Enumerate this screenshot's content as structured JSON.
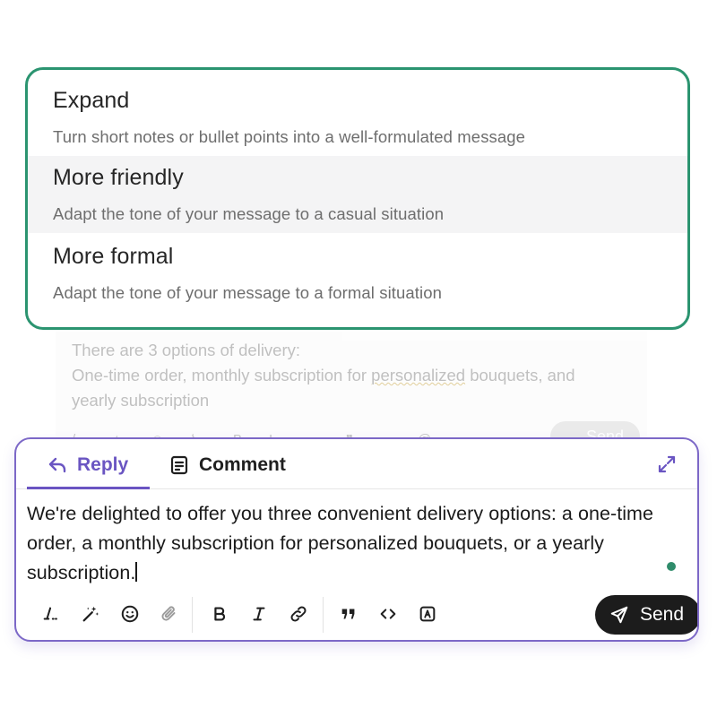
{
  "ai_menu": {
    "options": [
      {
        "title": "Expand",
        "description": "Turn short notes or bullet points into a well-formulated message"
      },
      {
        "title": "More friendly",
        "description": "Adapt the tone of your message to a casual situation"
      },
      {
        "title": "More formal",
        "description": "Adapt the tone of your message to a formal situation"
      }
    ],
    "highlighted_option": "More friendly",
    "border_color": "#2b9470"
  },
  "ghost_editor": {
    "line1": "There are 3 options of delivery:",
    "line2_pre": "One-time order, monthly subscription for ",
    "line2_word": "personalized",
    "line2_post": " bouquets, and",
    "line3": "yearly subscription",
    "send_label": "Send"
  },
  "composer": {
    "tabs": {
      "reply": "Reply",
      "comment": "Comment"
    },
    "active_tab": "Reply",
    "accent_color": "#6a55c2",
    "text": "We're delighted to offer you three convenient delivery options: a one-time order, a monthly subscription for personalized bouquets, or a yearly subscription.",
    "send_label": "Send",
    "toolbar_icons": [
      "text-format-icon",
      "magic-wand-icon",
      "emoji-icon",
      "attachment-icon",
      "bold-icon",
      "italic-icon",
      "link-icon",
      "quote-icon",
      "code-icon",
      "mention-icon"
    ],
    "status_dot_color": "#2f8c6b"
  }
}
